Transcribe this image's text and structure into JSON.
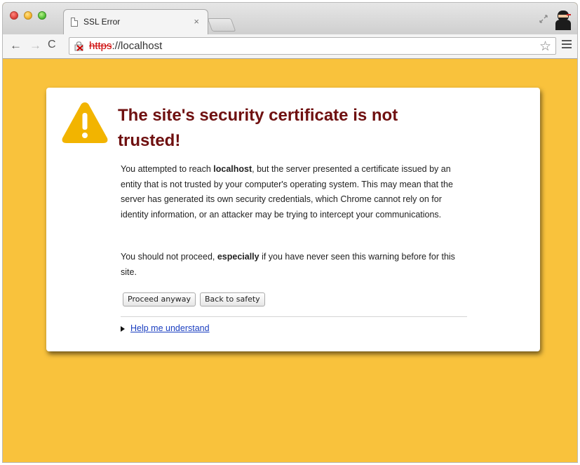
{
  "tab": {
    "title": "SSL Error",
    "close_label": "×"
  },
  "toolbar": {
    "back_label": "←",
    "forward_label": "→",
    "reload_label": "C",
    "url_scheme": "https",
    "url_rest": "://localhost"
  },
  "icons": {
    "page": "page-icon",
    "broken_lock": "broken-lock-icon",
    "star": "star-icon",
    "menu": "menu-icon",
    "warning": "warning-triangle-icon",
    "restore": "restore-icon"
  },
  "error": {
    "title": "The site's security certificate is not trusted!",
    "p1_a": "You attempted to reach ",
    "p1_host": "localhost",
    "p1_b": ", but the server presented a certificate issued by an entity that is not trusted by your computer's operating system. This may mean that the server has generated its own security credentials, which Chrome cannot rely on for identity information, or an attacker may be trying to intercept your communications.",
    "p2_a": "You should not proceed, ",
    "p2_em": "especially",
    "p2_b": " if you have never seen this warning before for this site.",
    "proceed_label": "Proceed anyway",
    "back_label": "Back to safety",
    "help_label": "Help me understand"
  },
  "colors": {
    "page_background": "#f9c23c",
    "title": "#6f1010",
    "warning_icon": "#f2b400",
    "link": "#1a3ec0",
    "url_scheme": "#cc0000"
  }
}
